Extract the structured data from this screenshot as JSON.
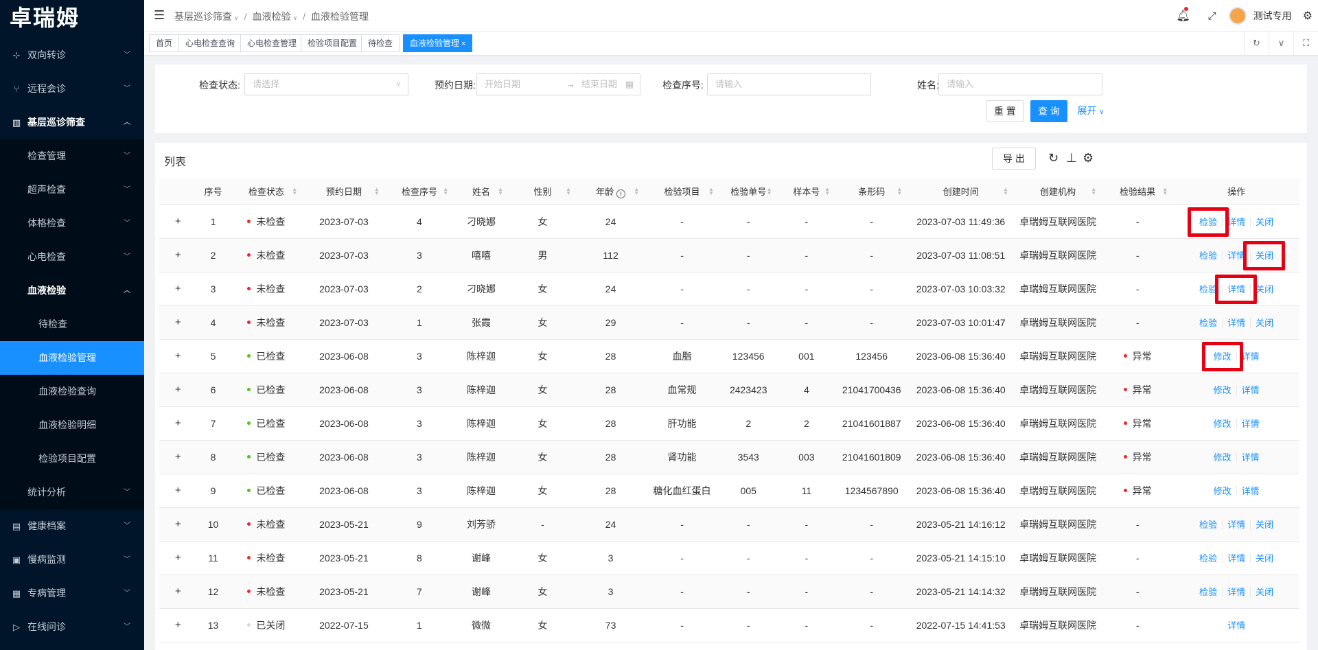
{
  "app": {
    "logo": "卓瑞姆"
  },
  "sidebar": {
    "items": [
      {
        "label": "双向转诊",
        "icon": "transfer-icon"
      },
      {
        "label": "远程会诊",
        "icon": "branch-icon"
      },
      {
        "label": "基层巡诊筛查",
        "icon": "chart-icon"
      }
    ],
    "sub": [
      {
        "label": "检查管理"
      },
      {
        "label": "超声检查"
      },
      {
        "label": "体格检查"
      },
      {
        "label": "心电检查"
      },
      {
        "label": "血液检验"
      }
    ],
    "sub2": [
      {
        "label": "待检查"
      },
      {
        "label": "血液检验管理"
      },
      {
        "label": "血液检验查询"
      },
      {
        "label": "血液检验明细"
      },
      {
        "label": "检验项目配置"
      }
    ],
    "sub_after": {
      "label": "统计分析"
    },
    "bottom": [
      {
        "label": "健康档案",
        "icon": "archive-icon"
      },
      {
        "label": "慢病监测",
        "icon": "monitor-icon"
      },
      {
        "label": "专病管理",
        "icon": "manage-icon"
      },
      {
        "label": "在线问诊",
        "icon": "send-icon"
      }
    ]
  },
  "header": {
    "breadcrumb": [
      "基层巡诊筛查",
      "血液检验",
      "血液检验管理"
    ],
    "user": "测试专用"
  },
  "tabs": [
    "首页",
    "心电检查查询",
    "心电检查管理",
    "检验项目配置",
    "待检查",
    "血液检验管理"
  ],
  "search": {
    "status_label": "检查状态:",
    "status_placeholder": "请选择",
    "date_label": "预约日期:",
    "date_start": "开始日期",
    "date_arrow": "→",
    "date_end": "结束日期",
    "seq_label": "检查序号:",
    "seq_placeholder": "请输入",
    "name_label": "姓名:",
    "name_placeholder": "请输入",
    "reset": "重 置",
    "query": "查 询",
    "expand": "展开"
  },
  "table": {
    "title": "列表",
    "export": "导 出",
    "columns": [
      "序号",
      "检查状态",
      "预约日期",
      "检查序号",
      "姓名",
      "性别",
      "年龄",
      "检验项目",
      "检验单号",
      "样本号",
      "条形码",
      "创建时间",
      "创建机构",
      "检验结果",
      "操作"
    ],
    "rows": [
      {
        "no": "1",
        "status": "未检查",
        "sc": "red",
        "date": "2023-07-03",
        "seq": "4",
        "name": "刁晓娜",
        "sex": "女",
        "age": "24",
        "item": "-",
        "order": "-",
        "sample": "-",
        "barcode": "-",
        "created": "2023-07-03 11:49:36",
        "org": "卓瑞姆互联网医院",
        "result": "-",
        "rc": "",
        "actions": [
          "检验",
          "详情",
          "关闭"
        ]
      },
      {
        "no": "2",
        "status": "未检查",
        "sc": "red",
        "date": "2023-07-03",
        "seq": "3",
        "name": "嘻嘻",
        "sex": "男",
        "age": "112",
        "item": "-",
        "order": "-",
        "sample": "-",
        "barcode": "-",
        "created": "2023-07-03 11:08:51",
        "org": "卓瑞姆互联网医院",
        "result": "-",
        "rc": "",
        "actions": [
          "检验",
          "详情",
          "关闭"
        ]
      },
      {
        "no": "3",
        "status": "未检查",
        "sc": "red",
        "date": "2023-07-03",
        "seq": "2",
        "name": "刁晓娜",
        "sex": "女",
        "age": "24",
        "item": "-",
        "order": "-",
        "sample": "-",
        "barcode": "-",
        "created": "2023-07-03 10:03:32",
        "org": "卓瑞姆互联网医院",
        "result": "-",
        "rc": "",
        "actions": [
          "检验",
          "详情",
          "关闭"
        ]
      },
      {
        "no": "4",
        "status": "未检查",
        "sc": "red",
        "date": "2023-07-03",
        "seq": "1",
        "name": "张霞",
        "sex": "女",
        "age": "29",
        "item": "-",
        "order": "-",
        "sample": "-",
        "barcode": "-",
        "created": "2023-07-03 10:01:47",
        "org": "卓瑞姆互联网医院",
        "result": "-",
        "rc": "",
        "actions": [
          "检验",
          "详情",
          "关闭"
        ]
      },
      {
        "no": "5",
        "status": "已检查",
        "sc": "green",
        "date": "2023-06-08",
        "seq": "3",
        "name": "陈梓迦",
        "sex": "女",
        "age": "28",
        "item": "血脂",
        "order": "123456",
        "sample": "001",
        "barcode": "123456",
        "created": "2023-06-08 15:36:40",
        "org": "卓瑞姆互联网医院",
        "result": "异常",
        "rc": "red",
        "actions": [
          "修改",
          "详情"
        ]
      },
      {
        "no": "6",
        "status": "已检查",
        "sc": "green",
        "date": "2023-06-08",
        "seq": "3",
        "name": "陈梓迦",
        "sex": "女",
        "age": "28",
        "item": "血常规",
        "order": "2423423",
        "sample": "4",
        "barcode": "21041700436",
        "created": "2023-06-08 15:36:40",
        "org": "卓瑞姆互联网医院",
        "result": "异常",
        "rc": "red",
        "actions": [
          "修改",
          "详情"
        ]
      },
      {
        "no": "7",
        "status": "已检查",
        "sc": "green",
        "date": "2023-06-08",
        "seq": "3",
        "name": "陈梓迦",
        "sex": "女",
        "age": "28",
        "item": "肝功能",
        "order": "2",
        "sample": "2",
        "barcode": "21041601887",
        "created": "2023-06-08 15:36:40",
        "org": "卓瑞姆互联网医院",
        "result": "异常",
        "rc": "red",
        "actions": [
          "修改",
          "详情"
        ]
      },
      {
        "no": "8",
        "status": "已检查",
        "sc": "green",
        "date": "2023-06-08",
        "seq": "3",
        "name": "陈梓迦",
        "sex": "女",
        "age": "28",
        "item": "肾功能",
        "order": "3543",
        "sample": "003",
        "barcode": "21041601809",
        "created": "2023-06-08 15:36:40",
        "org": "卓瑞姆互联网医院",
        "result": "异常",
        "rc": "red",
        "actions": [
          "修改",
          "详情"
        ]
      },
      {
        "no": "9",
        "status": "已检查",
        "sc": "green",
        "date": "2023-06-08",
        "seq": "3",
        "name": "陈梓迦",
        "sex": "女",
        "age": "28",
        "item": "糖化血红蛋白",
        "order": "005",
        "sample": "11",
        "barcode": "1234567890",
        "created": "2023-06-08 15:36:40",
        "org": "卓瑞姆互联网医院",
        "result": "异常",
        "rc": "red",
        "actions": [
          "修改",
          "详情"
        ]
      },
      {
        "no": "10",
        "status": "未检查",
        "sc": "red",
        "date": "2023-05-21",
        "seq": "9",
        "name": "刘芳骄",
        "sex": "-",
        "age": "24",
        "item": "-",
        "order": "-",
        "sample": "-",
        "barcode": "-",
        "created": "2023-05-21 14:16:12",
        "org": "卓瑞姆互联网医院",
        "result": "-",
        "rc": "",
        "actions": [
          "检验",
          "详情",
          "关闭"
        ]
      },
      {
        "no": "11",
        "status": "未检查",
        "sc": "red",
        "date": "2023-05-21",
        "seq": "8",
        "name": "谢峰",
        "sex": "女",
        "age": "3",
        "item": "-",
        "order": "-",
        "sample": "-",
        "barcode": "-",
        "created": "2023-05-21 14:15:10",
        "org": "卓瑞姆互联网医院",
        "result": "-",
        "rc": "",
        "actions": [
          "检验",
          "详情",
          "关闭"
        ]
      },
      {
        "no": "12",
        "status": "未检查",
        "sc": "red",
        "date": "2023-05-21",
        "seq": "7",
        "name": "谢峰",
        "sex": "女",
        "age": "3",
        "item": "-",
        "order": "-",
        "sample": "-",
        "barcode": "-",
        "created": "2023-05-21 14:14:32",
        "org": "卓瑞姆互联网医院",
        "result": "-",
        "rc": "",
        "actions": [
          "检验",
          "详情",
          "关闭"
        ]
      },
      {
        "no": "13",
        "status": "已关闭",
        "sc": "grey",
        "date": "2022-07-15",
        "seq": "1",
        "name": "微微",
        "sex": "女",
        "age": "73",
        "item": "-",
        "order": "-",
        "sample": "-",
        "barcode": "-",
        "created": "2022-07-15 14:41:53",
        "org": "卓瑞姆互联网医院",
        "result": "-",
        "rc": "",
        "actions": [
          "详情"
        ]
      }
    ]
  },
  "colors": {
    "primary": "#1890ff",
    "sidebar": "#001529",
    "highlight": "#e60012"
  }
}
